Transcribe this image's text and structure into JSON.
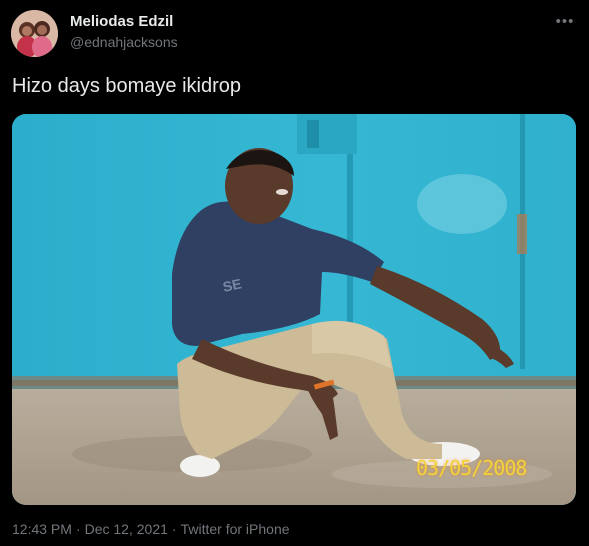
{
  "tweet": {
    "author_name": "Meliodas Edzil",
    "author_handle": "@ednahjacksons",
    "text": "Hizo days bomaye ikidrop",
    "media": {
      "photo_date_stamp": "03/05/2008",
      "description_icon": "photo"
    },
    "time": "12:43 PM",
    "separator": "·",
    "date": "Dec 12, 2021",
    "source": "Twitter for iPhone",
    "more_icon": "more-horizontal-icon"
  },
  "colors": {
    "background": "#000000",
    "primary_text": "#e7e9ea",
    "secondary_text": "#71767b",
    "wall": "#2fb3cf",
    "date_stamp": "#f0d43a"
  }
}
